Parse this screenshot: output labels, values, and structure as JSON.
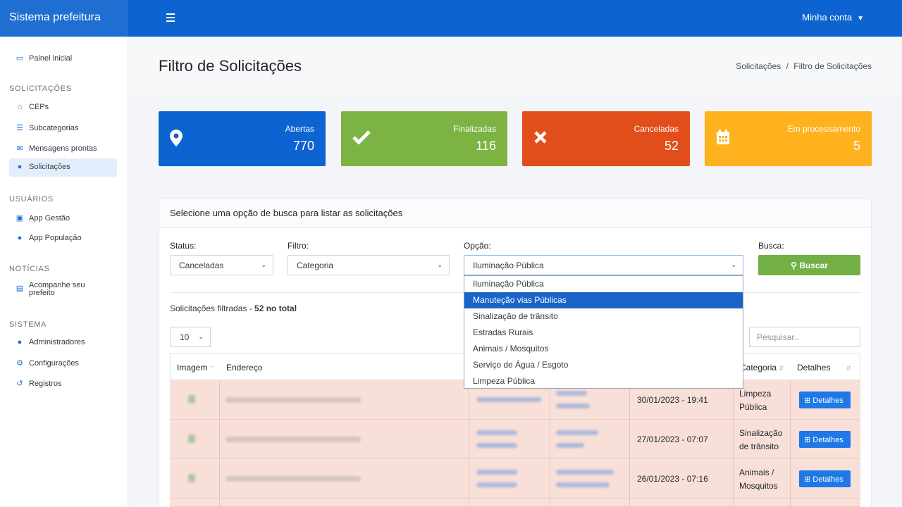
{
  "app": {
    "title": "Sistema prefeitura",
    "account_label": "Minha conta"
  },
  "sidebar": {
    "dashboard": "Painel inicial",
    "sections": [
      {
        "heading": "SOLICITAÇÕES",
        "items": [
          "CEPs",
          "Subcategorias",
          "Mensagens prontas",
          "Solicitações"
        ]
      },
      {
        "heading": "USUÁRIOS",
        "items": [
          "App Gestão",
          "App População"
        ]
      },
      {
        "heading": "NOTÍCIAS",
        "items": [
          "Acompanhe seu",
          "prefeito"
        ]
      },
      {
        "heading": "SISTEMA",
        "items": [
          "Administradores",
          "Configurações",
          "Registros"
        ]
      }
    ]
  },
  "page": {
    "title": "Filtro de Solicitações",
    "breadcrumb": {
      "parent": "Solicitações",
      "sep": "/",
      "current": "Filtro de Solicitações"
    }
  },
  "cards": [
    {
      "label": "Abertas",
      "value": "770",
      "color": "#0d63d0",
      "icon": "map-pin-icon"
    },
    {
      "label": "Finalizadas",
      "value": "116",
      "color": "#7cb342",
      "icon": "check-icon"
    },
    {
      "label": "Canceladas",
      "value": "52",
      "color": "#e24e1b",
      "icon": "x-icon"
    },
    {
      "label": "Em processamento",
      "value": "5",
      "color": "#ffb11e",
      "icon": "calendar-icon"
    }
  ],
  "panel": {
    "heading": "Selecione uma opção de busca para listar as solicitações",
    "status_label": "Status:",
    "status_value": "Canceladas",
    "filtro_label": "Filtro:",
    "filtro_value": "Categoria",
    "opcao_label": "Opção:",
    "opcao_value": "Iluminação Pública",
    "busca_label": "Busca:",
    "buscar_button": "Buscar",
    "filtered_prefix": "Solicitações filtradas - ",
    "filtered_count": "52 no total",
    "page_size": "10",
    "search_placeholder": "Pesquisar.."
  },
  "dropdown_options": [
    "Iluminação Pública",
    "Manuteção vias Públicas",
    "Sinalização de trânsito",
    "Estradas Rurais",
    "Animais / Mosquitos",
    "Serviço de Água / Esgoto",
    "Limpeza Pública"
  ],
  "dropdown_highlighted": "Manuteção vias Públicas",
  "table": {
    "headers": [
      "Imagem",
      "Endereço",
      "Categoria",
      "Detalhes"
    ],
    "rows": [
      {
        "date": "30/01/2023 - 19:41",
        "category_1": "Limpeza",
        "category_2": "Pública",
        "action": "Detalhes"
      },
      {
        "date": "27/01/2023 - 07:07",
        "category_1": "Sinalização",
        "category_2": "de trânsito",
        "action": "Detalhes"
      },
      {
        "date": "26/01/2023 - 07:16",
        "category_1": "Animais /",
        "category_2": "Mosquitos",
        "action": "Detalhes"
      }
    ]
  }
}
